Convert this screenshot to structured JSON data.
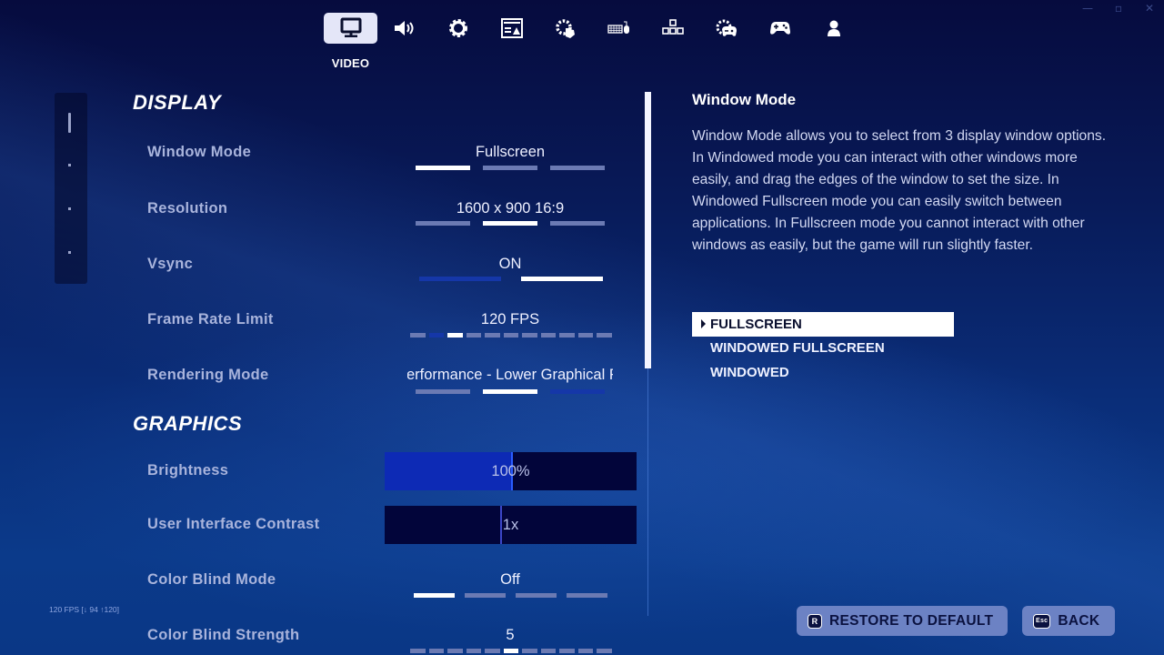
{
  "window_controls": [
    "minimize-icon",
    "maximize-icon",
    "close-icon"
  ],
  "topnav": {
    "active_index": 0,
    "active_label": "VIDEO",
    "tabs": [
      {
        "icon": "monitor-icon",
        "label": "VIDEO"
      },
      {
        "icon": "speaker-icon",
        "label": "AUDIO"
      },
      {
        "icon": "gear-icon",
        "label": "GAME"
      },
      {
        "icon": "ui-layout-icon",
        "label": "ACCESSIBILITY"
      },
      {
        "icon": "touch-settings-icon",
        "label": "TOUCH"
      },
      {
        "icon": "keyboard-mouse-icon",
        "label": "KEYBOARD"
      },
      {
        "icon": "arrow-keys-icon",
        "label": "CONTROLS"
      },
      {
        "icon": "controller-settings-icon",
        "label": "CONTROLLER SETTINGS"
      },
      {
        "icon": "gamepad-icon",
        "label": "CONTROLLER"
      },
      {
        "icon": "account-icon",
        "label": "ACCOUNT"
      }
    ]
  },
  "side_nav": {
    "sections": 4,
    "active_index": 0
  },
  "display": {
    "title": "DISPLAY",
    "rows": [
      {
        "label": "Window Mode",
        "value": "Fullscreen",
        "options_count": 3,
        "selected_index": 0
      },
      {
        "label": "Resolution",
        "value": "1600 x 900 16:9",
        "options_count": 3,
        "selected_index": 1
      },
      {
        "label": "Vsync",
        "value": "ON",
        "options_count": 2,
        "selected_index": 1
      },
      {
        "label": "Frame Rate Limit",
        "value": "120 FPS",
        "options_count": 11,
        "selected_index": 2
      },
      {
        "label": "Rendering Mode",
        "value": "Performance - Lower Graphical Fidelity",
        "options_count": 3,
        "selected_index": 1
      }
    ]
  },
  "graphics": {
    "title": "GRAPHICS",
    "brightness": {
      "label": "Brightness",
      "value": "100%",
      "fill_fraction": 0.5
    },
    "ui_contrast": {
      "label": "User Interface Contrast",
      "value": "1x",
      "fill_fraction": 0.46
    },
    "color_blind_mode": {
      "label": "Color Blind Mode",
      "value": "Off",
      "options_count": 4,
      "selected_index": 0
    },
    "color_blind_strength": {
      "label": "Color Blind Strength",
      "value": "5",
      "options_count": 11,
      "selected_index": 5
    }
  },
  "description": {
    "title": "Window Mode",
    "body": "Window Mode allows you to select from 3 display window options. In Windowed mode you can interact with other windows more easily, and drag the edges of the window to set the size. In Windowed Fullscreen mode you can easily switch between applications. In Fullscreen mode you cannot interact with other windows as easily, but the game will run slightly faster.",
    "options": [
      "FULLSCREEN",
      "WINDOWED FULLSCREEN",
      "WINDOWED"
    ],
    "selected_index": 0
  },
  "fps_counter": "120 FPS [↓ 94 ↑120]",
  "buttons": {
    "restore": {
      "key": "R",
      "label": "RESTORE TO DEFAULT"
    },
    "back": {
      "key": "Esc",
      "label": "BACK"
    }
  },
  "colors": {
    "accent_blue": "#0d2ab5",
    "segment_on": "#ffffff",
    "segment_off": "#6b7ab3",
    "button_bg": "#6c82c4"
  }
}
